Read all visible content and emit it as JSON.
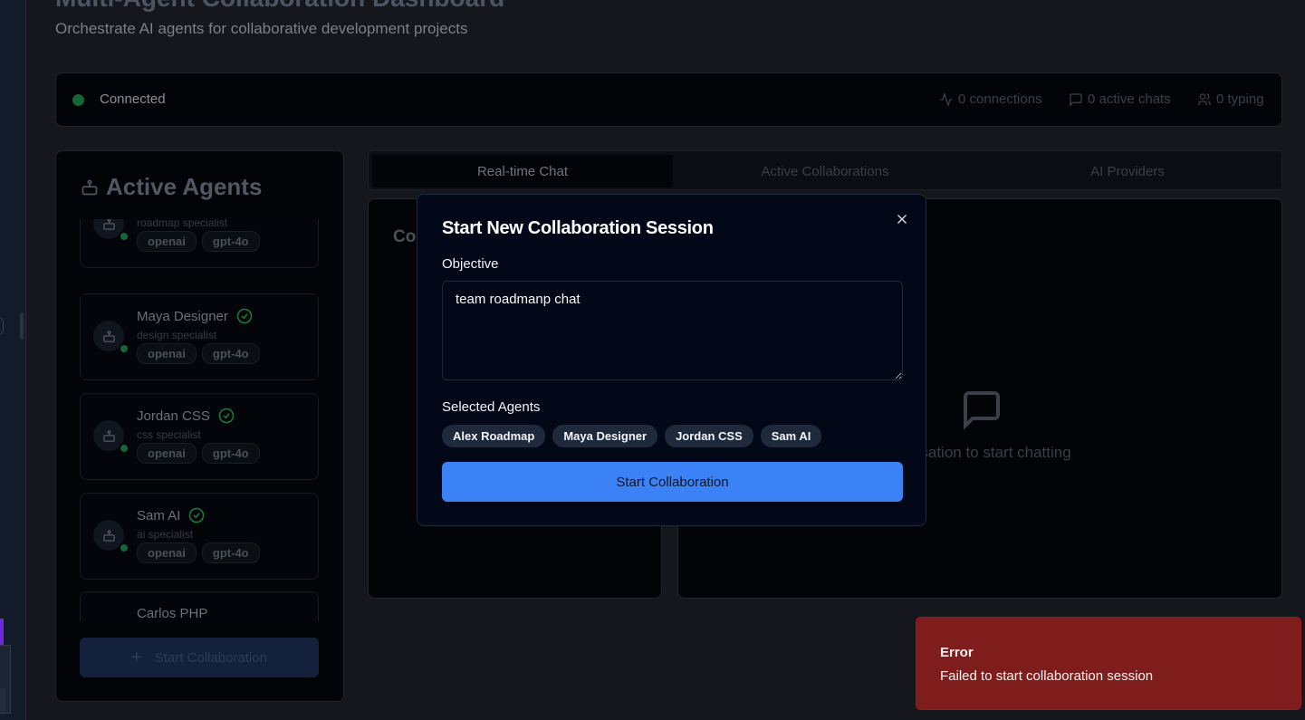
{
  "page": {
    "title": "Multi-Agent Collaboration Dashboard",
    "subtitle": "Orchestrate AI agents for collaborative development projects"
  },
  "status": {
    "connection": "Connected",
    "connections": "0 connections",
    "active_chats": "0 active chats",
    "typing": "0 typing"
  },
  "agents_panel": {
    "title": "Active Agents",
    "agents": [
      {
        "name": "Alex Roadmap",
        "specialty": "roadmap specialist",
        "provider": "openai",
        "model": "gpt-4o"
      },
      {
        "name": "Maya Designer",
        "specialty": "design specialist",
        "provider": "openai",
        "model": "gpt-4o"
      },
      {
        "name": "Jordan CSS",
        "specialty": "css specialist",
        "provider": "openai",
        "model": "gpt-4o"
      },
      {
        "name": "Sam AI",
        "specialty": "ai specialist",
        "provider": "openai",
        "model": "gpt-4o"
      },
      {
        "name": "Carlos PHP",
        "specialty": "",
        "provider": "",
        "model": ""
      }
    ],
    "start_button": "Start Collaboration"
  },
  "tabs": [
    "Real-time Chat",
    "Active Collaborations",
    "AI Providers"
  ],
  "conversations_panel": {
    "title": "Co"
  },
  "chat_panel": {
    "empty_message": "nversation to start chatting"
  },
  "modal": {
    "title": "Start New Collaboration Session",
    "objective_label": "Objective",
    "objective_value": "team roadmanp chat",
    "selected_label": "Selected Agents",
    "selected_agents": [
      "Alex Roadmap",
      "Maya Designer",
      "Jordan CSS",
      "Sam AI"
    ],
    "start_button": "Start Collaboration"
  },
  "toast": {
    "title": "Error",
    "description": "Failed to start collaboration session"
  },
  "colors": {
    "accent": "#3b82f6",
    "error": "#7f1d1d",
    "online": "#166534",
    "verified": "#15803d"
  }
}
